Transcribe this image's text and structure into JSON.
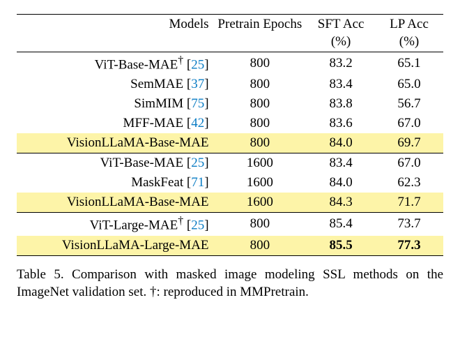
{
  "headers": {
    "models": "Models",
    "epochs": "Pretrain Epochs",
    "sft": "SFT Acc",
    "lp": "LP Acc",
    "pct": "(%)"
  },
  "groups": [
    {
      "rows": [
        {
          "model": "ViT-Base-MAE",
          "dag": "†",
          "cite": "25",
          "epochs": "800",
          "sft": "83.2",
          "lp": "65.1",
          "hl": false
        },
        {
          "model": "SemMAE",
          "dag": "",
          "cite": "37",
          "epochs": "800",
          "sft": "83.4",
          "lp": "65.0",
          "hl": false
        },
        {
          "model": "SimMIM",
          "dag": "",
          "cite": "75",
          "epochs": "800",
          "sft": "83.8",
          "lp": "56.7",
          "hl": false
        },
        {
          "model": "MFF-MAE",
          "dag": "",
          "cite": "42",
          "epochs": "800",
          "sft": "83.6",
          "lp": "67.0",
          "hl": false
        },
        {
          "model": "VisionLLaMA-Base-MAE",
          "dag": "",
          "cite": "",
          "epochs": "800",
          "sft": "84.0",
          "lp": "69.7",
          "hl": true
        }
      ]
    },
    {
      "rows": [
        {
          "model": "ViT-Base-MAE",
          "dag": "",
          "cite": "25",
          "epochs": "1600",
          "sft": "83.4",
          "lp": "67.0",
          "hl": false
        },
        {
          "model": "MaskFeat",
          "dag": "",
          "cite": "71",
          "epochs": "1600",
          "sft": "84.0",
          "lp": "62.3",
          "hl": false
        },
        {
          "model": "VisionLLaMA-Base-MAE",
          "dag": "",
          "cite": "",
          "epochs": "1600",
          "sft": "84.3",
          "lp": "71.7",
          "hl": true
        }
      ]
    },
    {
      "rows": [
        {
          "model": "ViT-Large-MAE",
          "dag": "†",
          "cite": "25",
          "epochs": "800",
          "sft": "85.4",
          "lp": "73.7",
          "hl": false
        },
        {
          "model": "VisionLLaMA-Large-MAE",
          "dag": "",
          "cite": "",
          "epochs": "800",
          "sft": "85.5",
          "lp": "77.3",
          "hl": true,
          "bold": true
        }
      ]
    }
  ],
  "caption": "Table 5. Comparison with masked image modeling SSL methods on the ImageNet validation set. †: reproduced in MMPretrain.",
  "chart_data": {
    "type": "table",
    "title": "Comparison with masked image modeling SSL methods on the ImageNet validation set",
    "columns": [
      "Models",
      "Pretrain Epochs",
      "SFT Acc (%)",
      "LP Acc (%)"
    ],
    "rows": [
      [
        "ViT-Base-MAE† [25]",
        800,
        83.2,
        65.1
      ],
      [
        "SemMAE [37]",
        800,
        83.4,
        65.0
      ],
      [
        "SimMIM [75]",
        800,
        83.8,
        56.7
      ],
      [
        "MFF-MAE [42]",
        800,
        83.6,
        67.0
      ],
      [
        "VisionLLaMA-Base-MAE",
        800,
        84.0,
        69.7
      ],
      [
        "ViT-Base-MAE [25]",
        1600,
        83.4,
        67.0
      ],
      [
        "MaskFeat [71]",
        1600,
        84.0,
        62.3
      ],
      [
        "VisionLLaMA-Base-MAE",
        1600,
        84.3,
        71.7
      ],
      [
        "ViT-Large-MAE† [25]",
        800,
        85.4,
        73.7
      ],
      [
        "VisionLLaMA-Large-MAE",
        800,
        85.5,
        77.3
      ]
    ]
  }
}
